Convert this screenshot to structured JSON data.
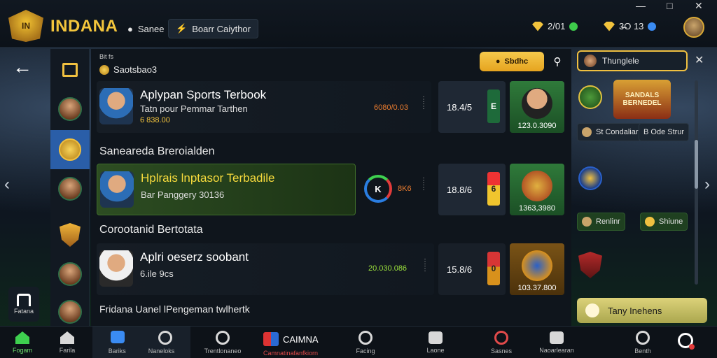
{
  "header": {
    "brand": "INDANA",
    "games_label": "Sanee",
    "search_tab_label": "Boarr Caiythor",
    "coins_1": "2/01",
    "coins_2": "3̶O 13",
    "win_min": "—",
    "win_max": "□",
    "win_close": "✕"
  },
  "left_rail": {
    "side_badge_label": "Fatana"
  },
  "main": {
    "small_label": "Bit fs",
    "sub_label": "Saotsbao3",
    "search_pill": "Sbdhc",
    "sections": [
      "Saneareda Breroialden",
      "Corootanid Bertotata",
      "Fridana Uanel lPengeman twlhertk"
    ],
    "matches": [
      {
        "title": "Aplypan Sports Terbook",
        "subtitle": "Tatn pour Pemmar Tarthen",
        "odds_small": "6 838.00",
        "mid_value": "6080/0.03",
        "odds": "18.4/5",
        "prize": "123.0.3090"
      },
      {
        "title": "Hplrais lnptasor Terbadile",
        "subtitle": "Bar Panggery 30136",
        "ring_label": "K",
        "mid_value": "8K6",
        "odds": "18.8/6",
        "prize": "1363,3980"
      },
      {
        "title": "Aplri oeserz soobant",
        "subtitle": "6.ile 9cs",
        "mid_value": "20.030.086",
        "odds": "15.8/6",
        "prize": "103.37.800"
      }
    ]
  },
  "right": {
    "header": "Thunglele",
    "banner": "SANDALS BERNEDEL",
    "pill_1": "St Condaliar",
    "pill_2": "B Ode Strur",
    "pill_3": "Renlinr",
    "pill_4": "Shiune",
    "cta": "Tany Inehens"
  },
  "bottom_nav": [
    {
      "label": "Fogam"
    },
    {
      "label": "Farila"
    },
    {
      "label": "Bariks"
    },
    {
      "label": "Naneloks"
    },
    {
      "label": "Trentlonaneo"
    },
    {
      "label": "Facing"
    },
    {
      "label": "Laone"
    },
    {
      "label": "Sasnes"
    },
    {
      "label": "Naoarlearan"
    },
    {
      "label": "Benth"
    }
  ],
  "bottom_cinema": {
    "label": "CAIMNA",
    "sub": "Camnatinafanfkiorn"
  }
}
